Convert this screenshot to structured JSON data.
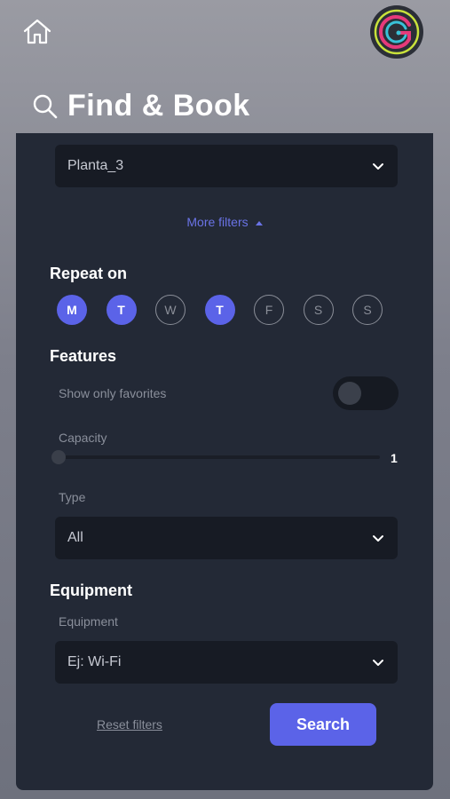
{
  "header": {
    "home_icon": "home-icon",
    "avatar_icon": "user-avatar-logo",
    "title": "Find & Book",
    "search_icon": "search-icon"
  },
  "location_select": {
    "value": "Planta_3"
  },
  "more_filters": {
    "label": "More filters"
  },
  "repeat_on": {
    "title": "Repeat on",
    "days": [
      {
        "label": "M",
        "selected": true
      },
      {
        "label": "T",
        "selected": true
      },
      {
        "label": "W",
        "selected": false
      },
      {
        "label": "T",
        "selected": true
      },
      {
        "label": "F",
        "selected": false
      },
      {
        "label": "S",
        "selected": false
      },
      {
        "label": "S",
        "selected": false
      }
    ]
  },
  "features": {
    "title": "Features",
    "favorites_label": "Show only favorites",
    "favorites_on": false,
    "capacity_label": "Capacity",
    "capacity_value": "1",
    "type_label": "Type",
    "type_value": "All"
  },
  "equipment": {
    "title": "Equipment",
    "label": "Equipment",
    "placeholder": "Ej: Wi-Fi"
  },
  "actions": {
    "reset_label": "Reset filters",
    "search_label": "Search"
  },
  "colors": {
    "accent": "#5b63e8",
    "panel": "#232936",
    "input_bg": "#171b24"
  }
}
